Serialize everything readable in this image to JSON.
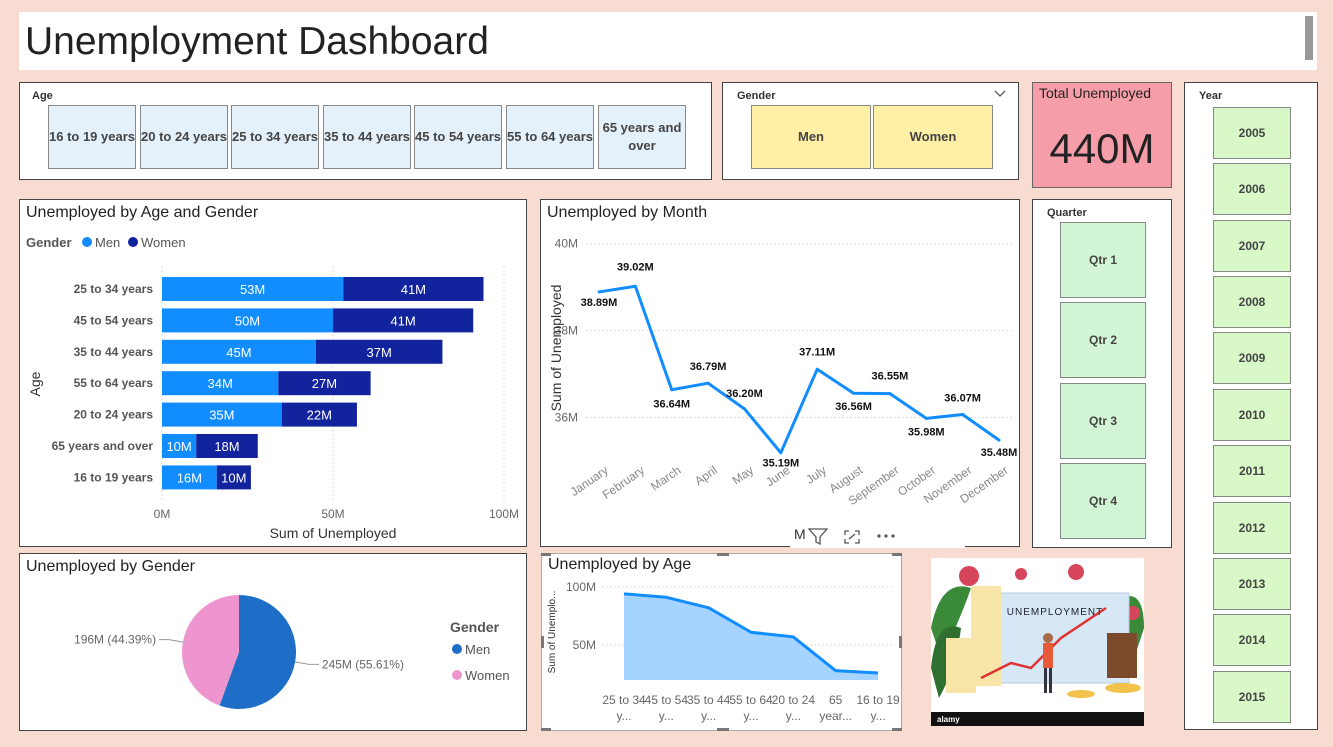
{
  "title": "Unemployment Dashboard",
  "age_slicer": {
    "label": "Age",
    "options": [
      "16 to 19 years",
      "20 to 24 years",
      "25 to 34 years",
      "35 to 44 years",
      "45 to 54 years",
      "55 to 64 years",
      "65 years and over"
    ]
  },
  "gender_slicer": {
    "label": "Gender",
    "options": [
      "Men",
      "Women"
    ]
  },
  "kpi": {
    "label": "Total Unemployed",
    "value": "440M"
  },
  "quarter_slicer": {
    "label": "Quarter",
    "options": [
      "Qtr 1",
      "Qtr 2",
      "Qtr 3",
      "Qtr 4"
    ]
  },
  "year_slicer": {
    "label": "Year",
    "options": [
      "2005",
      "2006",
      "2007",
      "2008",
      "2009",
      "2010",
      "2011",
      "2012",
      "2013",
      "2014",
      "2015"
    ]
  },
  "colors": {
    "men": "#118DFF",
    "women": "#12239E",
    "pie_men": "#1E6EC8",
    "pie_women": "#EE95CF",
    "line": "#118DFF",
    "area_fill": "#9ACFFF",
    "kpi_bg": "#F59DA8"
  },
  "image_panel": {
    "caption": "UNEMPLOYMENT",
    "watermark": "alamy"
  },
  "visual_header": {
    "partial_text": "M",
    "icons": [
      "filter-icon",
      "focus-mode-icon",
      "more-options-icon"
    ]
  },
  "charts": {
    "age_gender": {
      "title": "Unemployed by Age and Gender",
      "legend_title": "Gender",
      "xlabel": "Sum of Unemployed",
      "ylabel": "Age",
      "x_ticks": [
        "0M",
        "50M",
        "100M"
      ]
    },
    "month": {
      "title": "Unemployed by Month",
      "ylabel": "Sum of Unemployed",
      "y_ticks": [
        "40M",
        "38M",
        "36M"
      ]
    },
    "gender": {
      "title": "Unemployed by Gender",
      "legend_title": "Gender",
      "men_label": "245M (55.61%)",
      "women_label": "196M (44.39%)"
    },
    "age": {
      "title": "Unemployed by Age",
      "ylabel": "Sum of Unemplo...",
      "y_ticks": [
        "100M",
        "50M"
      ]
    }
  },
  "chart_data": [
    {
      "type": "bar",
      "title": "Unemployed by Age and Gender",
      "orientation": "horizontal",
      "stacked": true,
      "categories": [
        "25 to 34 years",
        "45 to 54 years",
        "35 to 44 years",
        "55 to 64 years",
        "20 to 24 years",
        "65 years and over",
        "16 to 19 years"
      ],
      "series": [
        {
          "name": "Men",
          "values": [
            53,
            50,
            45,
            34,
            35,
            10,
            16
          ],
          "labels": [
            "53M",
            "50M",
            "45M",
            "34M",
            "35M",
            "10M",
            "16M"
          ]
        },
        {
          "name": "Women",
          "values": [
            41,
            41,
            37,
            27,
            22,
            18,
            10
          ],
          "labels": [
            "41M",
            "41M",
            "37M",
            "27M",
            "22M",
            "18M",
            "10M"
          ]
        }
      ],
      "xlabel": "Sum of Unemployed",
      "ylabel": "Age",
      "xlim": [
        0,
        100
      ],
      "legend": "top-left"
    },
    {
      "type": "line",
      "title": "Unemployed by Month",
      "x": [
        "January",
        "February",
        "March",
        "April",
        "May",
        "June",
        "July",
        "August",
        "September",
        "October",
        "November",
        "December"
      ],
      "y": [
        38.89,
        39.02,
        36.64,
        36.79,
        36.2,
        35.19,
        37.11,
        36.56,
        36.55,
        35.98,
        36.07,
        35.48
      ],
      "labels": [
        "38.89M",
        "39.02M",
        "36.64M",
        "36.79M",
        "36.20M",
        "35.19M",
        "37.11M",
        "36.56M",
        "36.55M",
        "35.98M",
        "36.07M",
        "35.48M"
      ],
      "ylabel": "Sum of Unemployed",
      "ylim": [
        35,
        40.2
      ]
    },
    {
      "type": "pie",
      "title": "Unemployed by Gender",
      "categories": [
        "Men",
        "Women"
      ],
      "values": [
        245,
        196
      ],
      "percent": [
        55.61,
        44.39
      ],
      "legend": "right"
    },
    {
      "type": "area",
      "title": "Unemployed by Age",
      "categories": [
        "25 to 34 y...",
        "45 to 54 y...",
        "35 to 44 y...",
        "55 to 64 y...",
        "20 to 24 y...",
        "65 year...",
        "16 to 19 y..."
      ],
      "values": [
        94,
        91,
        82,
        61,
        57,
        28,
        26
      ],
      "ylabel": "Sum of Unemplo...",
      "ylim": [
        20,
        105
      ]
    }
  ]
}
